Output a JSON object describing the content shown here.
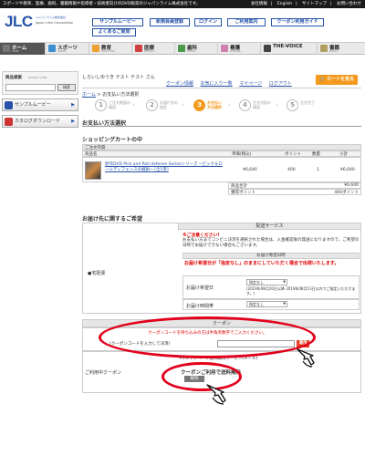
{
  "topbar": {
    "tagline": "スポーツや教育、医療、歯科、書籍情報や指導者・技術者向けのDVD販売のジャパンライム株式会社です。",
    "links": [
      "会社情報",
      "English",
      "サイトマップ",
      "お問い合わせ"
    ]
  },
  "logo": {
    "text": "JLC",
    "sub1": "ジャパンライム株式会社",
    "sub2": "Japan Lime Corporation"
  },
  "header_buttons": [
    "サンプルムービー",
    "新規会員登録",
    "ログイン",
    "ご利用案内",
    "クーポン利用ガイド",
    "よくあるご質問"
  ],
  "nav": [
    {
      "label": "ホーム",
      "en": "HOME",
      "color": "#777777"
    },
    {
      "label": "スポーツ",
      "en": "SPORTS",
      "color": "#3d8fd0"
    },
    {
      "label": "教育",
      "en": "EDUCATION",
      "color": "#f0a030"
    },
    {
      "label": "医療",
      "en": "MEDICAL",
      "color": "#d04040"
    },
    {
      "label": "歯科",
      "en": "DENTAL",
      "color": "#4a9a4a"
    },
    {
      "label": "看護",
      "en": "NURSING",
      "color": "#d080b0"
    },
    {
      "label": "THE-VOICE",
      "en": "",
      "color": "#444444"
    },
    {
      "label": "書籍",
      "en": "BOOKS",
      "color": "#b0a060"
    }
  ],
  "sidebar": {
    "search_title": "商品検索",
    "search_en": "SEARCH ITEM",
    "search_button": "検索",
    "sample_label": "サンプルムービー",
    "catalog_label": "カタログダウンロード"
  },
  "main": {
    "greeting": "しらいしゆうき テスト テスト さん",
    "userlinks": [
      "クーポン情報",
      "お気に入り一覧",
      "マイページ",
      "ログアウト"
    ],
    "cart_button": "カートを見る",
    "breadcrumb_home": "ホーム",
    "breadcrumb_current": "お支払い方法選択",
    "steps": [
      {
        "num": "1",
        "line1": "ご注文数量の",
        "line2": "確認"
      },
      {
        "num": "2",
        "line1": "お届け先の",
        "line2": "指定"
      },
      {
        "num": "3",
        "line1": "お支払い",
        "line2": "方法選択"
      },
      {
        "num": "4",
        "line1": "注文内容の",
        "line2": "確認"
      },
      {
        "num": "5",
        "line1": "注文完了",
        "line2": ""
      }
    ],
    "page_title": "お支払い方法選択",
    "cart_title": "ショッピングカートの中",
    "order_label": "ご注文内容",
    "table_headers": [
      "商品名",
      "単価(税込)",
      "ポイント",
      "数量",
      "小計"
    ],
    "item": {
      "name": "新作DVD Pick and Roll defense Seriesシリーズ ~ピック＆ロールディフェンスの戦術~ [全1巻]",
      "price": "¥6,640",
      "points": "400",
      "qty": "1",
      "subtotal": "¥6,640"
    },
    "total_label": "商品合計",
    "total_value": "¥6,640",
    "points_label": "獲得ポイント",
    "points_value": "400ポイント",
    "delivery_title": "お届け先に関するご希望",
    "delivery_service_label": "配送サービス",
    "delivery_method": "宅配便",
    "notice_title": "※ご注意ください!",
    "notice_text": "お支払い方法でコンビニ決済を選択された場合は、入金確認後の発送になりますので、ご希望の日時でお届けできない場合もございます。",
    "date_header": "お届け希望日時",
    "date_warning": "お届け希望日が「指定なし」のままにしていただく場合で出荷いたします。",
    "date_label": "お届け希望日",
    "date_select": "指定なし",
    "date_note": "(2019年08月20日以降 2019年08月13日以内でご指定いただけます。)",
    "time_label": "お届け時間帯",
    "time_select": "指定なし",
    "coupon_header": "クーポン",
    "coupon_hint": "クーポンコードを持ち込みの方は半角英数字でご入力ください。",
    "coupon_input_label": "(クーポンコードを入力して決済)",
    "coupon_button": "適用",
    "current_coupon_label": "ご利用中クーポン",
    "current_coupon_value": "+1キャンペーン送料無料クーポン(メール)",
    "coupon_notice": "クーポンご利用で送料無料",
    "release_button": "解除"
  },
  "colors": {
    "accent": "#2553a8",
    "orange": "#f39a1e",
    "red": "#e2001a"
  }
}
